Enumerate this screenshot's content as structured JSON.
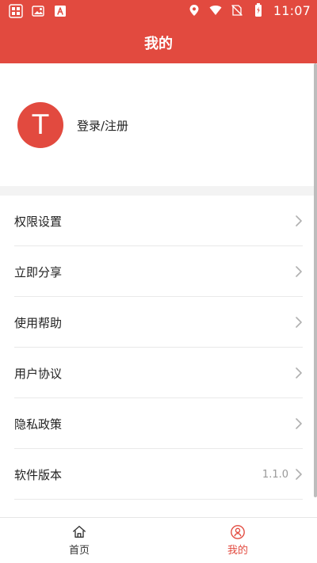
{
  "statusBar": {
    "time": "11:07",
    "leftIcons": [
      "app-icon",
      "image-icon",
      "document-icon"
    ],
    "rightIcons": [
      "location-icon",
      "wifi-icon",
      "no-sim-icon",
      "battery-charging-icon"
    ]
  },
  "header": {
    "title": "我的"
  },
  "profile": {
    "avatarLetter": "T",
    "loginText": "登录/注册"
  },
  "menu": {
    "items": [
      {
        "label": "权限设置"
      },
      {
        "label": "立即分享"
      },
      {
        "label": "使用帮助"
      },
      {
        "label": "用户协议"
      },
      {
        "label": "隐私政策"
      },
      {
        "label": "软件版本",
        "value": "1.1.0"
      }
    ]
  },
  "bottomNav": {
    "items": [
      {
        "label": "首页",
        "icon": "home-icon",
        "active": false
      },
      {
        "label": "我的",
        "icon": "profile-icon",
        "active": true
      }
    ]
  },
  "colors": {
    "primary": "#e24a3f",
    "text": "#222222",
    "secondaryText": "#999999",
    "divider": "#e9e9e9",
    "sectionBackground": "#f3f3f3"
  }
}
